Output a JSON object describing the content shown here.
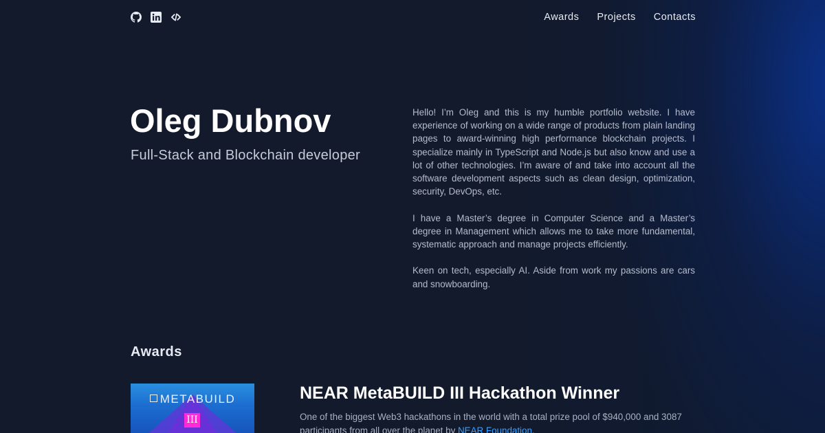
{
  "header": {
    "socials": [
      {
        "icon": "github-icon"
      },
      {
        "icon": "linkedin-icon"
      },
      {
        "icon": "codeforces-icon"
      }
    ],
    "nav": [
      "Awards",
      "Projects",
      "Contacts"
    ]
  },
  "hero": {
    "name": "Oleg Dubnov",
    "subtitle": "Full-Stack and Blockchain developer"
  },
  "bio": [
    "Hello! I’m Oleg and this is my humble portfolio website. I have experience of working on a wide range of products from plain landing pages to award-winning high performance blockchain projects. I specialize mainly in TypeScript and Node.js but also know and use a lot of other technologies. I’m aware of and take into account all the software development aspects such as clean design, optimization, security, DevOps, etc.",
    "I have a Master’s degree in Computer Science and a Master’s degree in Management which allows me to take more fundamental, systematic approach and manage projects efficiently.",
    "Keen on tech, especially AI. Aside from work my passions are cars and snowboarding."
  ],
  "awards": {
    "section_title": "Awards",
    "items": [
      {
        "image_text": "METABUILD",
        "image_badge": "III",
        "title": "NEAR MetaBUILD III Hackathon Winner",
        "desc_before_link": "One of the biggest Web3 hackathons in the world with a total prize pool of $940,000 and 3087 participants from all over the planet by ",
        "link_text": "NEAR Foundation",
        "desc_after_link": "."
      }
    ]
  },
  "colors": {
    "background": "#131a2b",
    "accent_link": "#3aa0ff",
    "badge_pink": "#ff2bd6"
  }
}
